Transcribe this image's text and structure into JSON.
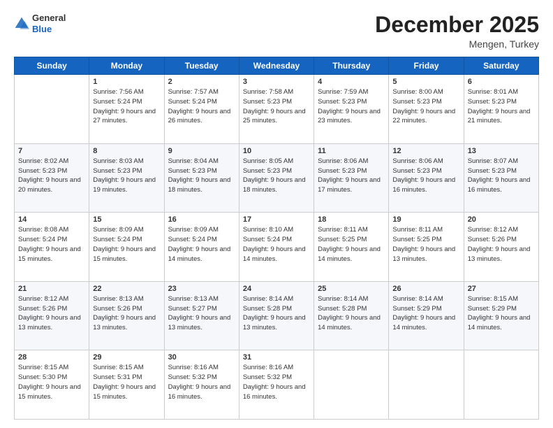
{
  "header": {
    "logo_general": "General",
    "logo_blue": "Blue",
    "month_title": "December 2025",
    "location": "Mengen, Turkey"
  },
  "days_of_week": [
    "Sunday",
    "Monday",
    "Tuesday",
    "Wednesday",
    "Thursday",
    "Friday",
    "Saturday"
  ],
  "weeks": [
    [
      {
        "day": "",
        "sunrise": "",
        "sunset": "",
        "daylight": ""
      },
      {
        "day": "1",
        "sunrise": "Sunrise: 7:56 AM",
        "sunset": "Sunset: 5:24 PM",
        "daylight": "Daylight: 9 hours and 27 minutes."
      },
      {
        "day": "2",
        "sunrise": "Sunrise: 7:57 AM",
        "sunset": "Sunset: 5:24 PM",
        "daylight": "Daylight: 9 hours and 26 minutes."
      },
      {
        "day": "3",
        "sunrise": "Sunrise: 7:58 AM",
        "sunset": "Sunset: 5:23 PM",
        "daylight": "Daylight: 9 hours and 25 minutes."
      },
      {
        "day": "4",
        "sunrise": "Sunrise: 7:59 AM",
        "sunset": "Sunset: 5:23 PM",
        "daylight": "Daylight: 9 hours and 23 minutes."
      },
      {
        "day": "5",
        "sunrise": "Sunrise: 8:00 AM",
        "sunset": "Sunset: 5:23 PM",
        "daylight": "Daylight: 9 hours and 22 minutes."
      },
      {
        "day": "6",
        "sunrise": "Sunrise: 8:01 AM",
        "sunset": "Sunset: 5:23 PM",
        "daylight": "Daylight: 9 hours and 21 minutes."
      }
    ],
    [
      {
        "day": "7",
        "sunrise": "Sunrise: 8:02 AM",
        "sunset": "Sunset: 5:23 PM",
        "daylight": "Daylight: 9 hours and 20 minutes."
      },
      {
        "day": "8",
        "sunrise": "Sunrise: 8:03 AM",
        "sunset": "Sunset: 5:23 PM",
        "daylight": "Daylight: 9 hours and 19 minutes."
      },
      {
        "day": "9",
        "sunrise": "Sunrise: 8:04 AM",
        "sunset": "Sunset: 5:23 PM",
        "daylight": "Daylight: 9 hours and 18 minutes."
      },
      {
        "day": "10",
        "sunrise": "Sunrise: 8:05 AM",
        "sunset": "Sunset: 5:23 PM",
        "daylight": "Daylight: 9 hours and 18 minutes."
      },
      {
        "day": "11",
        "sunrise": "Sunrise: 8:06 AM",
        "sunset": "Sunset: 5:23 PM",
        "daylight": "Daylight: 9 hours and 17 minutes."
      },
      {
        "day": "12",
        "sunrise": "Sunrise: 8:06 AM",
        "sunset": "Sunset: 5:23 PM",
        "daylight": "Daylight: 9 hours and 16 minutes."
      },
      {
        "day": "13",
        "sunrise": "Sunrise: 8:07 AM",
        "sunset": "Sunset: 5:23 PM",
        "daylight": "Daylight: 9 hours and 16 minutes."
      }
    ],
    [
      {
        "day": "14",
        "sunrise": "Sunrise: 8:08 AM",
        "sunset": "Sunset: 5:24 PM",
        "daylight": "Daylight: 9 hours and 15 minutes."
      },
      {
        "day": "15",
        "sunrise": "Sunrise: 8:09 AM",
        "sunset": "Sunset: 5:24 PM",
        "daylight": "Daylight: 9 hours and 15 minutes."
      },
      {
        "day": "16",
        "sunrise": "Sunrise: 8:09 AM",
        "sunset": "Sunset: 5:24 PM",
        "daylight": "Daylight: 9 hours and 14 minutes."
      },
      {
        "day": "17",
        "sunrise": "Sunrise: 8:10 AM",
        "sunset": "Sunset: 5:24 PM",
        "daylight": "Daylight: 9 hours and 14 minutes."
      },
      {
        "day": "18",
        "sunrise": "Sunrise: 8:11 AM",
        "sunset": "Sunset: 5:25 PM",
        "daylight": "Daylight: 9 hours and 14 minutes."
      },
      {
        "day": "19",
        "sunrise": "Sunrise: 8:11 AM",
        "sunset": "Sunset: 5:25 PM",
        "daylight": "Daylight: 9 hours and 13 minutes."
      },
      {
        "day": "20",
        "sunrise": "Sunrise: 8:12 AM",
        "sunset": "Sunset: 5:26 PM",
        "daylight": "Daylight: 9 hours and 13 minutes."
      }
    ],
    [
      {
        "day": "21",
        "sunrise": "Sunrise: 8:12 AM",
        "sunset": "Sunset: 5:26 PM",
        "daylight": "Daylight: 9 hours and 13 minutes."
      },
      {
        "day": "22",
        "sunrise": "Sunrise: 8:13 AM",
        "sunset": "Sunset: 5:26 PM",
        "daylight": "Daylight: 9 hours and 13 minutes."
      },
      {
        "day": "23",
        "sunrise": "Sunrise: 8:13 AM",
        "sunset": "Sunset: 5:27 PM",
        "daylight": "Daylight: 9 hours and 13 minutes."
      },
      {
        "day": "24",
        "sunrise": "Sunrise: 8:14 AM",
        "sunset": "Sunset: 5:28 PM",
        "daylight": "Daylight: 9 hours and 13 minutes."
      },
      {
        "day": "25",
        "sunrise": "Sunrise: 8:14 AM",
        "sunset": "Sunset: 5:28 PM",
        "daylight": "Daylight: 9 hours and 14 minutes."
      },
      {
        "day": "26",
        "sunrise": "Sunrise: 8:14 AM",
        "sunset": "Sunset: 5:29 PM",
        "daylight": "Daylight: 9 hours and 14 minutes."
      },
      {
        "day": "27",
        "sunrise": "Sunrise: 8:15 AM",
        "sunset": "Sunset: 5:29 PM",
        "daylight": "Daylight: 9 hours and 14 minutes."
      }
    ],
    [
      {
        "day": "28",
        "sunrise": "Sunrise: 8:15 AM",
        "sunset": "Sunset: 5:30 PM",
        "daylight": "Daylight: 9 hours and 15 minutes."
      },
      {
        "day": "29",
        "sunrise": "Sunrise: 8:15 AM",
        "sunset": "Sunset: 5:31 PM",
        "daylight": "Daylight: 9 hours and 15 minutes."
      },
      {
        "day": "30",
        "sunrise": "Sunrise: 8:16 AM",
        "sunset": "Sunset: 5:32 PM",
        "daylight": "Daylight: 9 hours and 16 minutes."
      },
      {
        "day": "31",
        "sunrise": "Sunrise: 8:16 AM",
        "sunset": "Sunset: 5:32 PM",
        "daylight": "Daylight: 9 hours and 16 minutes."
      },
      {
        "day": "",
        "sunrise": "",
        "sunset": "",
        "daylight": ""
      },
      {
        "day": "",
        "sunrise": "",
        "sunset": "",
        "daylight": ""
      },
      {
        "day": "",
        "sunrise": "",
        "sunset": "",
        "daylight": ""
      }
    ]
  ]
}
